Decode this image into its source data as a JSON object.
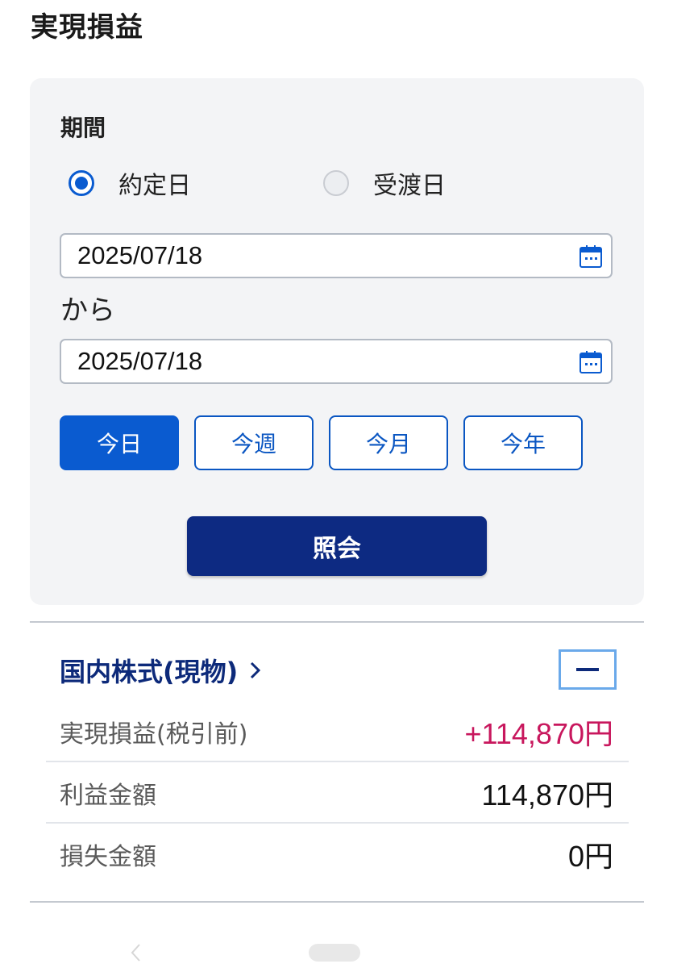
{
  "header": {
    "title": "実現損益"
  },
  "filter": {
    "period_label": "期間",
    "radio_options": [
      {
        "label": "約定日",
        "checked": true
      },
      {
        "label": "受渡日",
        "checked": false
      }
    ],
    "from_date": "2025/07/18",
    "to_date": "2025/07/18",
    "separator_label": "から",
    "quick_ranges": [
      {
        "label": "今日",
        "active": true
      },
      {
        "label": "今週",
        "active": false
      },
      {
        "label": "今月",
        "active": false
      },
      {
        "label": "今年",
        "active": false
      }
    ],
    "submit_label": "照会"
  },
  "section": {
    "title": "国内株式(現物)",
    "rows": [
      {
        "label": "実現損益(税引前)",
        "value": "+114,870円"
      },
      {
        "label": "利益金額",
        "value": "114,870円"
      },
      {
        "label": "損失金額",
        "value": "0円"
      }
    ]
  },
  "colors": {
    "accent": "#0a5bd0",
    "primary_dark": "#0d2a82",
    "positive": "#c8175d",
    "panel_bg": "#f3f4f6"
  },
  "icons": [
    "calendar-icon",
    "chevron-right-icon",
    "minus-icon",
    "back-icon"
  ]
}
